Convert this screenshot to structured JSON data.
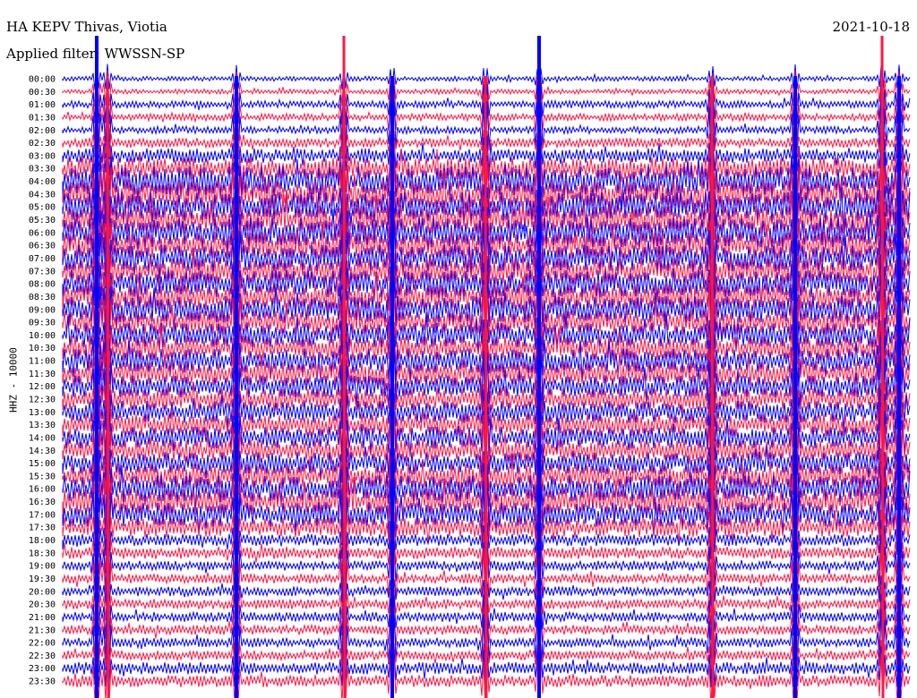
{
  "header": {
    "station": "HA KEPV Thivas, Viotia",
    "date": "2021-10-18",
    "filter": "Applied filter: WWSSN-SP"
  },
  "chart_data": {
    "type": "line",
    "title": "HA KEPV Thivas, Viotia",
    "subtitle": "Applied filter: WWSSN-SP",
    "date": "2021-10-18",
    "ylabel": "HHZ - 10000",
    "xlabel": "",
    "row_labels": [
      "00:00",
      "00:30",
      "01:00",
      "01:30",
      "02:00",
      "02:30",
      "03:00",
      "03:30",
      "04:00",
      "04:30",
      "05:00",
      "05:30",
      "06:00",
      "06:30",
      "07:00",
      "07:30",
      "08:00",
      "08:30",
      "09:00",
      "09:30",
      "10:00",
      "10:30",
      "11:00",
      "11:30",
      "12:00",
      "12:30",
      "13:00",
      "13:30",
      "14:00",
      "14:30",
      "15:00",
      "15:30",
      "16:00",
      "16:30",
      "17:00",
      "17:30",
      "18:00",
      "18:30",
      "19:00",
      "19:30",
      "20:00",
      "20:30",
      "21:00",
      "21:30",
      "22:00",
      "22:30",
      "23:00",
      "23:30"
    ],
    "row_colors": [
      "#0000ff",
      "#ff1744"
    ],
    "amplitude_by_hour": [
      2,
      2,
      3,
      3,
      3,
      4,
      6,
      9,
      12,
      12,
      12,
      12,
      12,
      11,
      11,
      11,
      11,
      11,
      11,
      10,
      10,
      10,
      10,
      10,
      9,
      9,
      9,
      9,
      9,
      9,
      9,
      10,
      11,
      11,
      10,
      8,
      5,
      5,
      4,
      4,
      4,
      4,
      4,
      4,
      4,
      4,
      5,
      5
    ]
  }
}
